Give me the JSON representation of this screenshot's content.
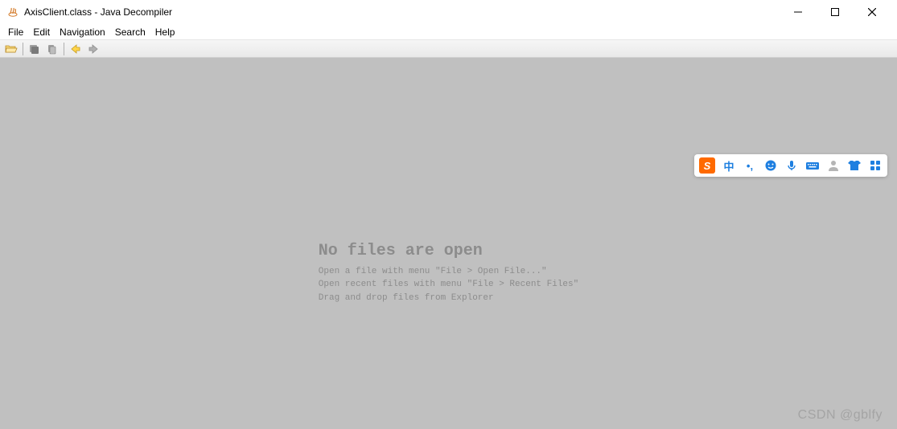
{
  "titlebar": {
    "title": "AxisClient.class - Java Decompiler"
  },
  "menubar": {
    "items": [
      "File",
      "Edit",
      "Navigation",
      "Search",
      "Help"
    ]
  },
  "toolbar": {
    "icons": [
      "open-file-icon",
      "save-all-icon",
      "copy-icon",
      "back-icon",
      "forward-icon"
    ]
  },
  "empty": {
    "title": "No files are open",
    "line1": "Open a file with menu \"File > Open File...\"",
    "line2": "Open recent files with menu \"File > Recent Files\"",
    "line3": "Drag and drop files from Explorer"
  },
  "ime": {
    "logo": "S",
    "lang": "中",
    "punct": "•,",
    "emoji_icon": "emoji",
    "mic_icon": "mic",
    "keyboard_icon": "keyboard",
    "person_icon": "person",
    "skin_icon": "tshirt",
    "grid_icon": "grid"
  },
  "watermark": "CSDN @gblfy"
}
